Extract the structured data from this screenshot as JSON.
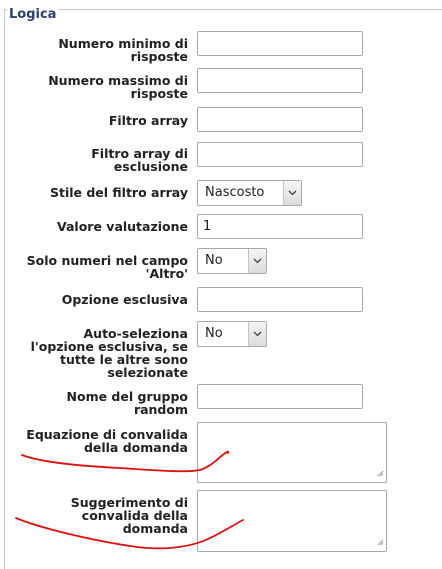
{
  "section": {
    "legend": "Logica"
  },
  "fields": {
    "min_answers": {
      "label_lines": [
        "Numero minimo di",
        "risposte"
      ],
      "value": ""
    },
    "max_answers": {
      "label_lines": [
        "Numero massimo di",
        "risposte"
      ],
      "value": ""
    },
    "array_filter": {
      "label_lines": [
        "Filtro array"
      ],
      "value": ""
    },
    "array_filter_exclusion": {
      "label_lines": [
        "Filtro array di",
        "esclusione"
      ],
      "value": ""
    },
    "array_filter_style": {
      "label_lines": [
        "Stile del filtro array"
      ],
      "selected": "Nascosto"
    },
    "assessment_value": {
      "label_lines": [
        "Valore valutazione"
      ],
      "value": "1"
    },
    "other_numbers_only": {
      "label_lines": [
        "Solo numeri nel campo",
        "'Altro'"
      ],
      "selected": "No"
    },
    "exclusive_option": {
      "label_lines": [
        "Opzione esclusiva"
      ],
      "value": ""
    },
    "autoselect_exclusive": {
      "label_lines": [
        "Auto-seleziona",
        "l'opzione esclusiva, se",
        "tutte le altre sono",
        "selezionate"
      ],
      "selected": "No"
    },
    "random_group": {
      "label_lines": [
        "Nome del gruppo",
        "random"
      ],
      "value": ""
    },
    "validation_equation": {
      "label_lines": [
        "Equazione di convalida",
        "della domanda"
      ],
      "value": ""
    },
    "validation_tip": {
      "label_lines": [
        "Suggerimento di",
        "convalida della",
        "domanda"
      ],
      "value": ""
    }
  },
  "icons": {
    "dropdown": "chevron-down-icon",
    "resize": "resize-grip-icon"
  },
  "colors": {
    "legend_text": "#2e3e6e",
    "annotation_stroke": "#e01010",
    "border": "#a9a9a9"
  }
}
